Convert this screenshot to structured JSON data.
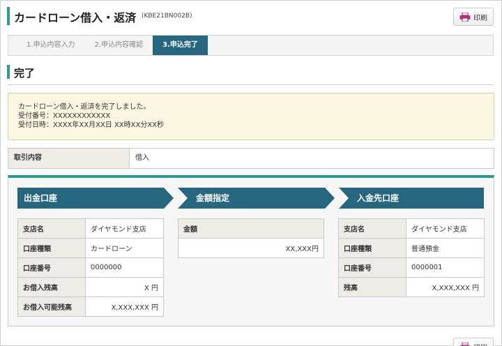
{
  "header": {
    "title": "カードローン借入・返済",
    "screen_id": "(KBE21BN002B)",
    "print_label": "印刷"
  },
  "steps": [
    {
      "label": "1.申込内容入力",
      "active": false
    },
    {
      "label": "2.申込内容確認",
      "active": false
    },
    {
      "label": "3.申込完了",
      "active": true
    }
  ],
  "section": {
    "title": "完了"
  },
  "message": {
    "line1": "カードローン借入・返済を完了しました。",
    "line2": "受付番号：XXXXXXXXXXXX",
    "line3": "受付日時：XXXX年XX月XX日 XX時XX分XX秒"
  },
  "transaction": {
    "label": "取引内容",
    "value": "借入"
  },
  "panels": {
    "withdraw": {
      "title": "出金口座",
      "rows": [
        {
          "label": "支店名",
          "value": "ダイヤモンド支店",
          "align": "left"
        },
        {
          "label": "口座種類",
          "value": "カードローン",
          "align": "left"
        },
        {
          "label": "口座番号",
          "value": "0000000",
          "align": "left"
        },
        {
          "label": "お借入残高",
          "value": "X 円",
          "align": "right"
        },
        {
          "label": "お借入可能残高",
          "value": "X,XXX,XXX 円",
          "align": "right"
        }
      ]
    },
    "amount": {
      "title": "金額指定",
      "label": "金額",
      "value": "XX,XXX円"
    },
    "deposit": {
      "title": "入金先口座",
      "rows": [
        {
          "label": "支店名",
          "value": "ダイヤモンド支店",
          "align": "left"
        },
        {
          "label": "口座種類",
          "value": "普通預金",
          "align": "left"
        },
        {
          "label": "口座番号",
          "value": "0000001",
          "align": "left"
        },
        {
          "label": "残高",
          "value": "X,XXX,XXX 円",
          "align": "right"
        }
      ]
    }
  },
  "colors": {
    "accent": "#2a9d8f",
    "step_active": "#26667f",
    "arrow": "#26667f",
    "print_icon": "#b5307a"
  }
}
